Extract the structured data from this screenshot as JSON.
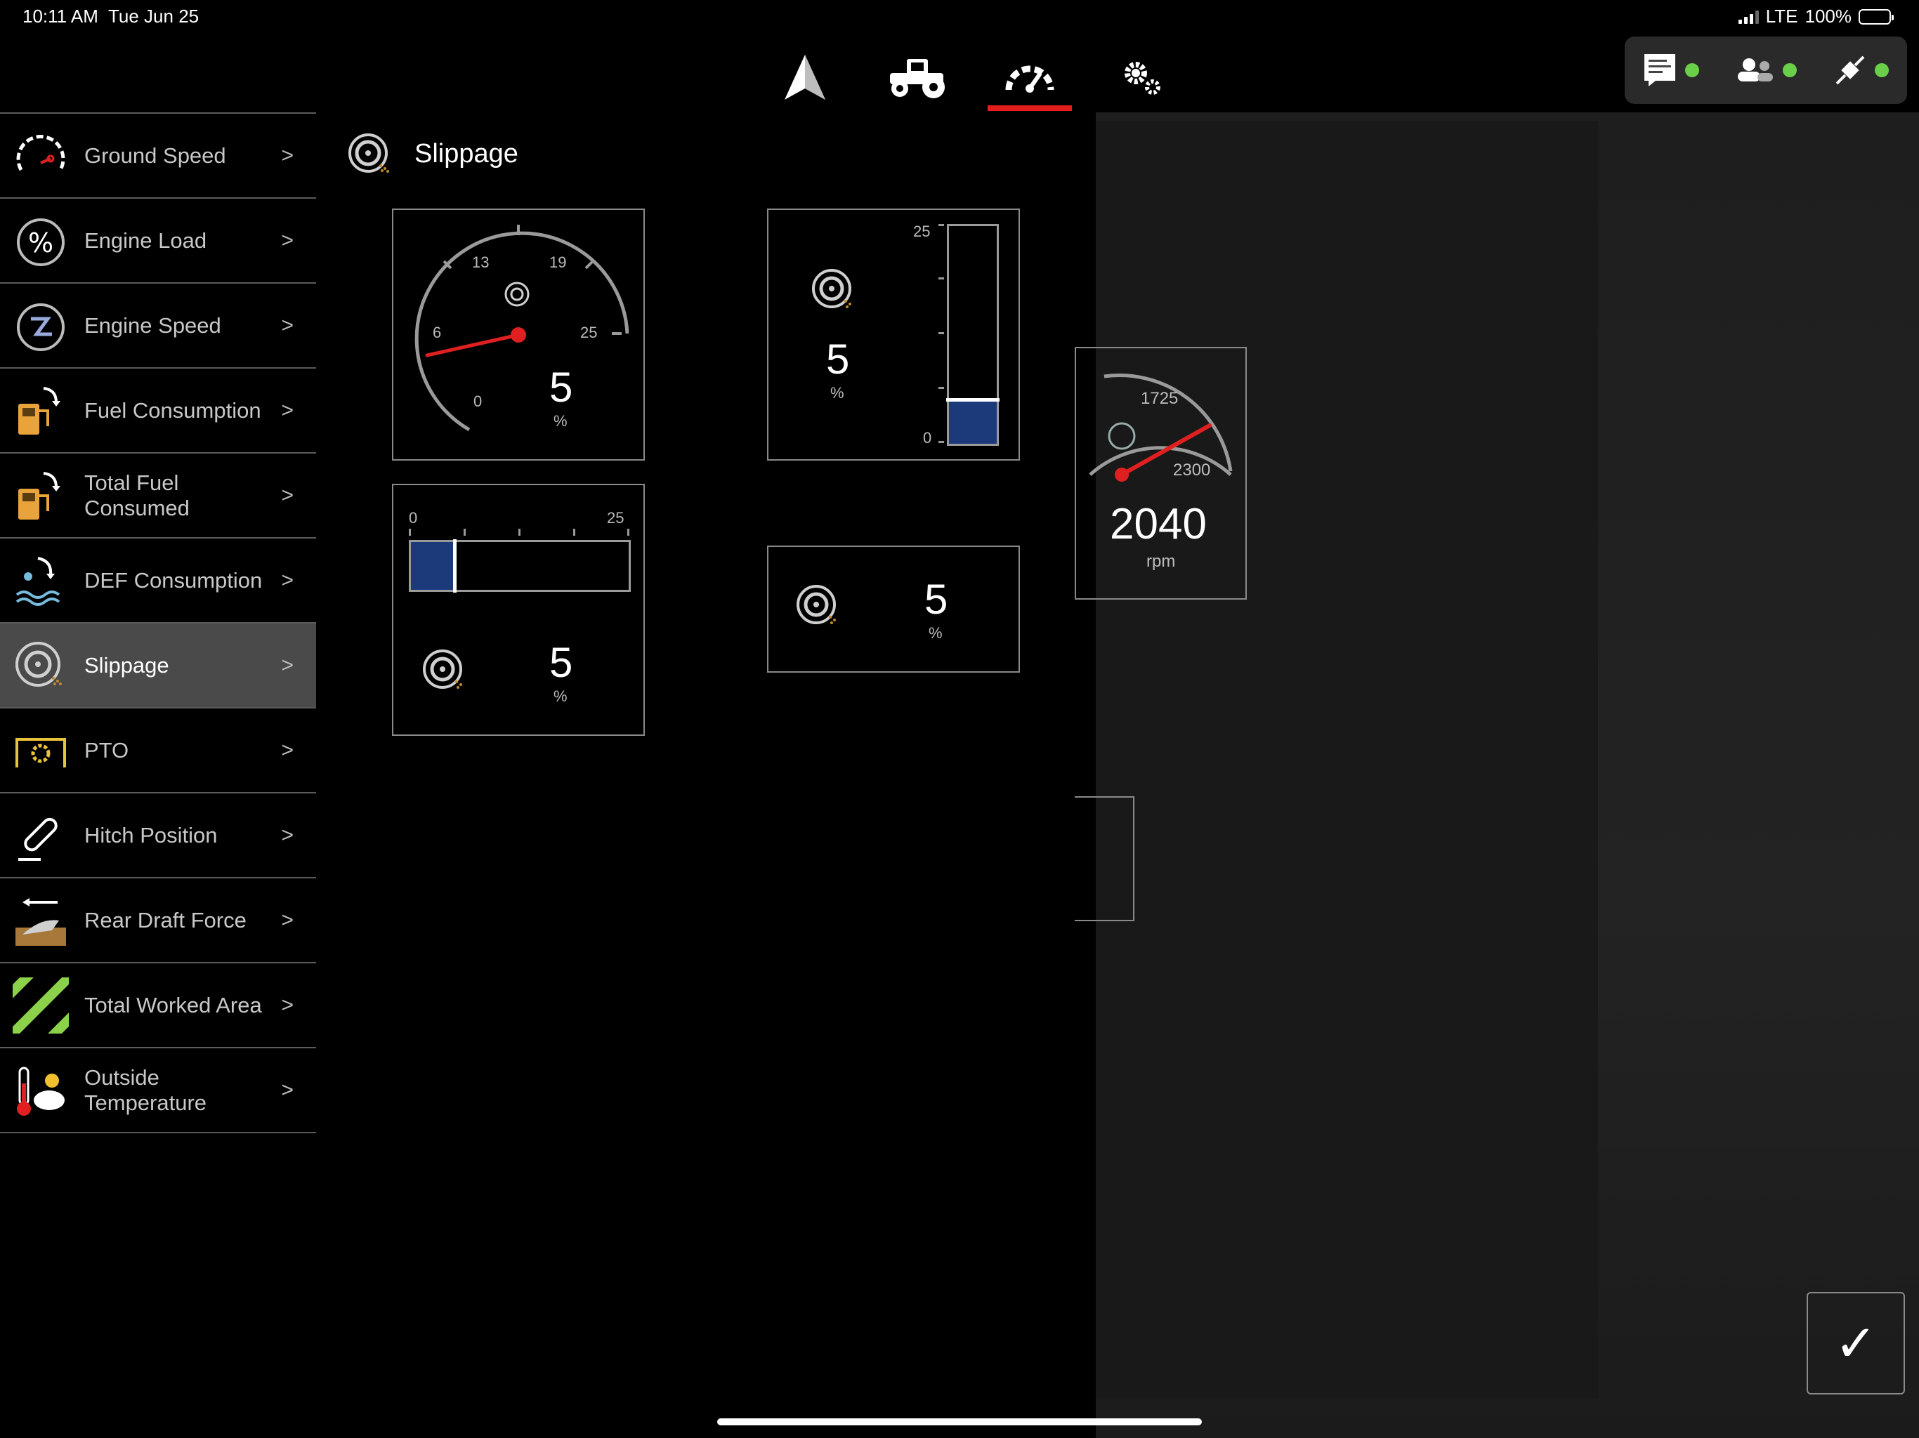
{
  "status": {
    "time": "10:11 AM",
    "date": "Tue Jun 25",
    "network": "LTE",
    "battery": "100%"
  },
  "topnav": {
    "tabs": [
      "navigation",
      "tractor",
      "gauges",
      "settings"
    ],
    "active_tab": "gauges"
  },
  "sidebar": {
    "items": [
      {
        "label": "Ground Speed",
        "icon": "speedometer-icon"
      },
      {
        "label": "Engine Load",
        "icon": "percent-icon"
      },
      {
        "label": "Engine Speed",
        "icon": "engine-speed-icon"
      },
      {
        "label": "Fuel Consumption",
        "icon": "fuel-pump-icon"
      },
      {
        "label": "Total Fuel Consumed",
        "icon": "fuel-pump-icon"
      },
      {
        "label": "DEF Consumption",
        "icon": "def-icon"
      },
      {
        "label": "Slippage",
        "icon": "slippage-icon",
        "active": true
      },
      {
        "label": "PTO",
        "icon": "pto-icon"
      },
      {
        "label": "Hitch Position",
        "icon": "hitch-icon"
      },
      {
        "label": "Rear Draft Force",
        "icon": "draft-force-icon"
      },
      {
        "label": "Total Worked Area",
        "icon": "worked-area-icon"
      },
      {
        "label": "Outside Temperature",
        "icon": "temperature-icon"
      }
    ],
    "chevron": ">"
  },
  "content": {
    "title": "Slippage",
    "dial_widget": {
      "ticks": [
        "0",
        "6",
        "13",
        "19",
        "25"
      ],
      "value": "5",
      "unit": "%"
    },
    "vbar_widget": {
      "max": "25",
      "min": "0",
      "value": "5",
      "unit": "%",
      "level_fraction": 0.2
    },
    "hbar_widget": {
      "min": "0",
      "max": "25",
      "value": "5",
      "unit": "%",
      "level_fraction": 0.2
    },
    "number_widget": {
      "value": "5",
      "unit": "%"
    }
  },
  "background_widget": {
    "ticks": [
      "1725",
      "2300"
    ],
    "value": "2040",
    "unit": "rpm"
  },
  "confirm": {
    "label": "✓"
  }
}
